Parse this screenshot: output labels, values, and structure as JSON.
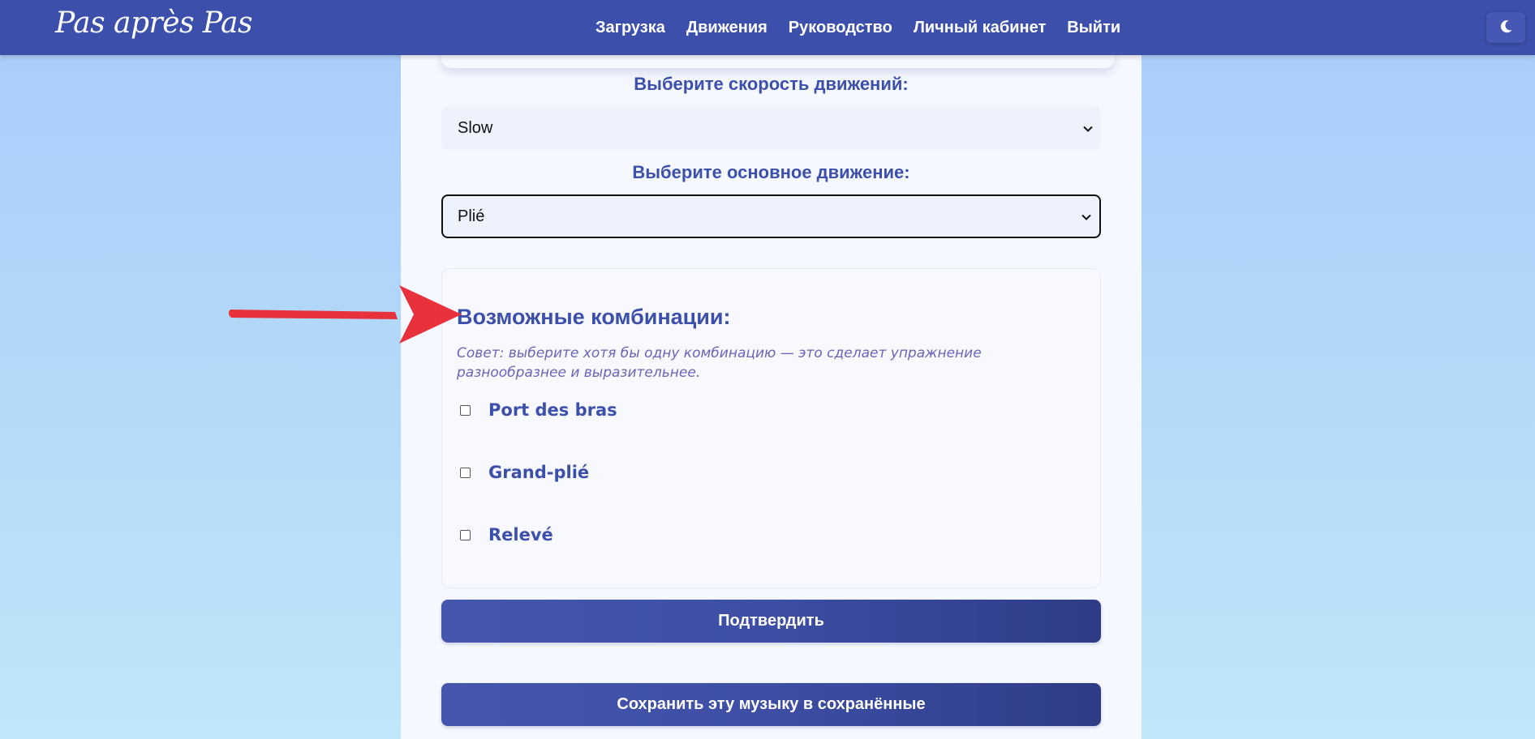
{
  "header": {
    "brand": "Pas après Pas",
    "nav": [
      "Загрузка",
      "Движения",
      "Руководство",
      "Личный кабинет",
      "Выйти"
    ],
    "theme_icon": "moon-icon"
  },
  "form": {
    "speed_label": "Выберите скорость движений:",
    "speed_value": "Slow",
    "movement_label": "Выберите основное движение:",
    "movement_value": "Plié"
  },
  "combinations": {
    "title": "Возможные комбинации:",
    "tip": "Совет: выберите хотя бы одну комбинацию — это сделает упражнение разнообразнее и выразительнее.",
    "items": [
      "Port des bras",
      "Grand-plié",
      "Relevé"
    ]
  },
  "buttons": {
    "confirm": "Подтвердить",
    "save_music": "Сохранить эту музыку в сохранённые"
  },
  "annotation": {
    "arrow_color": "#e8313a"
  },
  "colors": {
    "accent": "#3c4fab",
    "tip": "#6b63b5"
  }
}
